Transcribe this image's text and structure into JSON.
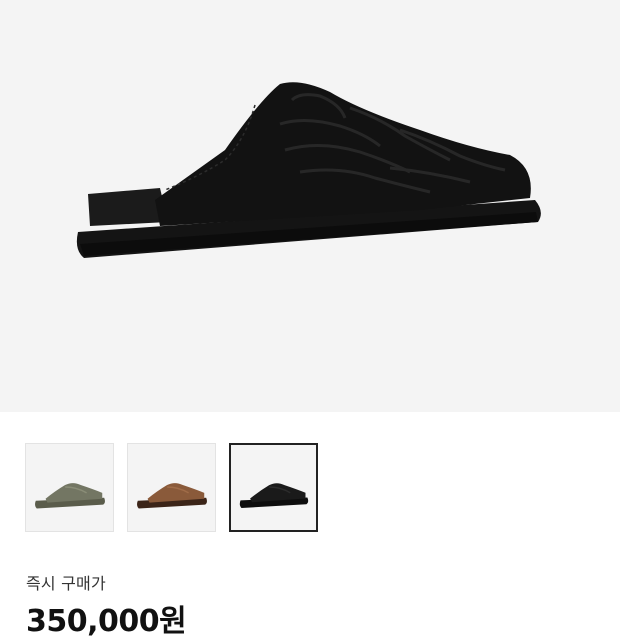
{
  "product": {
    "main_image": "black-suede-quilted-mule-slipper",
    "thumbnails": [
      {
        "name": "olive-variant",
        "color": "#6f725e",
        "selected": false
      },
      {
        "name": "brown-variant",
        "color": "#8a5a3a",
        "selected": false
      },
      {
        "name": "black-variant",
        "color": "#1a1a1a",
        "selected": true
      }
    ]
  },
  "pricing": {
    "label": "즉시 구매가",
    "price": "350,000원"
  },
  "colors": {
    "hero_bg": "#f4f4f4",
    "selected_border": "#222222"
  }
}
